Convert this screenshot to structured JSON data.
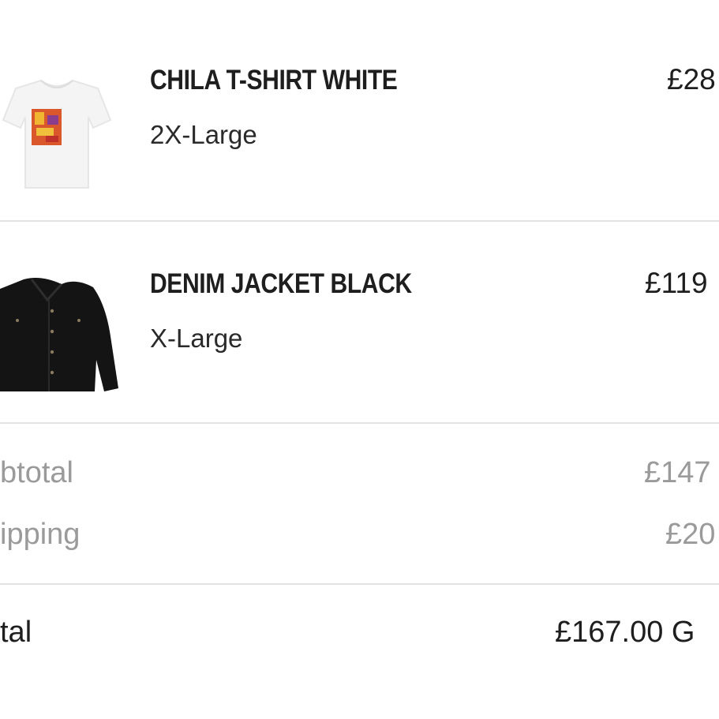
{
  "order": {
    "items": [
      {
        "title": "CHILA T-SHIRT WHITE",
        "variant": "2X-Large",
        "price": "£28"
      },
      {
        "title": "DENIM JACKET BLACK",
        "variant": "X-Large",
        "price": "£119"
      }
    ],
    "summary": {
      "subtotal_label": "btotal",
      "subtotal_value": "£147",
      "shipping_label": "ipping",
      "shipping_value": "£20",
      "total_label": "tal",
      "total_value": "£167.00 G"
    }
  },
  "icons": {
    "tshirt": "tshirt-product-image",
    "jacket": "denim-jacket-product-image"
  }
}
